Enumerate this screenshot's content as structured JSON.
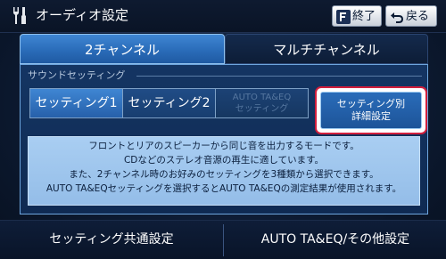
{
  "header": {
    "title": "オーディオ設定",
    "exit_label": "終了",
    "back_label": "戻る"
  },
  "tabs": [
    {
      "label": "2チャンネル",
      "active": true
    },
    {
      "label": "マルチチャンネル",
      "active": false
    }
  ],
  "sound_setting": {
    "section_label": "サウンドセッティング",
    "options": [
      {
        "label": "セッティング1",
        "selected": true
      },
      {
        "label": "セッティング2",
        "selected": false
      },
      {
        "label_line1": "AUTO TA&EQ",
        "label_line2": "セッティング",
        "enabled": false
      }
    ],
    "detail_button": {
      "line1": "セッティング別",
      "line2": "詳細設定"
    }
  },
  "description": [
    "フロントとリアのスピーカーから同じ音を出力するモードです。",
    "CDなどのステレオ音源の再生に適しています。",
    "また、2チャンネル時のお好みのセッティングを3種類から選択できます。",
    "AUTO TA&EQセッティングを選択するとAUTO TA&EQの測定結果が使用されます。"
  ],
  "bottom": {
    "common_settings": "セッティング共通設定",
    "auto_other": "AUTO TA&EQ/その他設定"
  },
  "colors": {
    "accent": "#2a6cb9",
    "highlight_outline": "#d21e3c",
    "description_bg": "#a9cef2"
  },
  "icons": [
    "tools-icon",
    "exit-icon",
    "back-arrow-icon"
  ]
}
